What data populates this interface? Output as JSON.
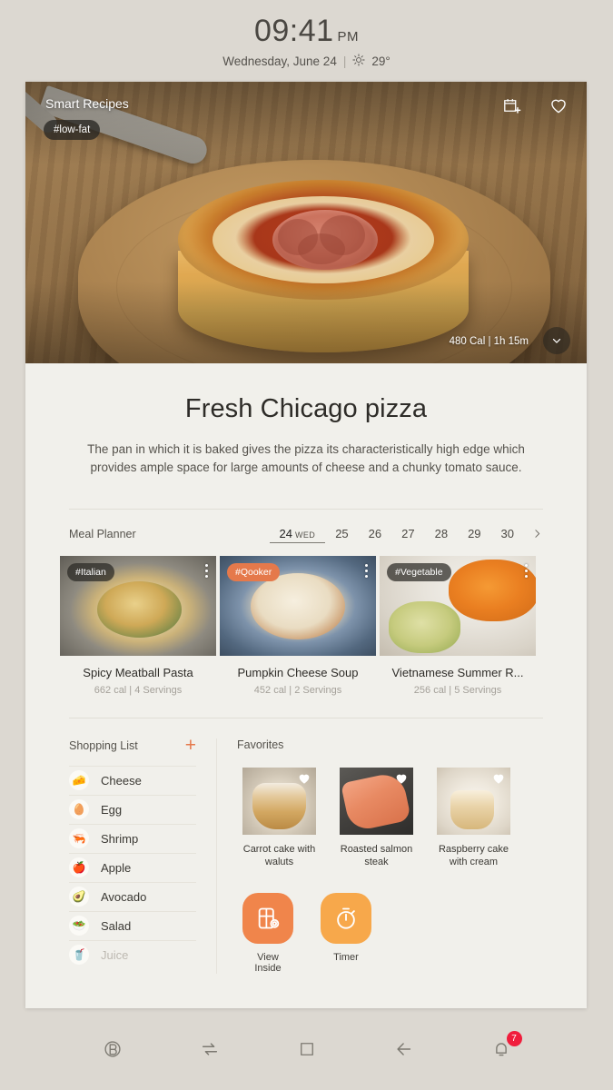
{
  "statusbar": {
    "time": "09:41",
    "ampm": "PM",
    "date": "Wednesday, June 24",
    "separator": "|",
    "temperature": "29°",
    "weather_icon": "sun-icon"
  },
  "hero": {
    "app_title": "Smart Recipes",
    "tag": "#low-fat",
    "meta": "480 Cal | 1h 15m",
    "icons": {
      "add_to_calendar": "calendar-plus-icon",
      "favorite": "heart-outline-icon",
      "expand": "chevron-down-icon"
    }
  },
  "recipe": {
    "title": "Fresh Chicago pizza",
    "description": "The pan in which it is baked gives the pizza its characteristically high edge which provides ample space for large amounts of cheese and a chunky tomato sauce."
  },
  "meal_planner": {
    "label": "Meal Planner",
    "selected_day": "24",
    "selected_dow": "WED",
    "days": [
      "25",
      "26",
      "27",
      "28",
      "29",
      "30"
    ],
    "next_icon": "chevron-right-icon",
    "cards": [
      {
        "tag": "#Italian",
        "tag_style": "dark",
        "name": "Spicy Meatball Pasta",
        "info": "662 cal | 4 Servings"
      },
      {
        "tag": "#Qooker",
        "tag_style": "orange",
        "name": "Pumpkin Cheese Soup",
        "info": "452 cal | 2 Servings"
      },
      {
        "tag": "#Vegetable",
        "tag_style": "dark",
        "name": "Vietnamese Summer R...",
        "info": "256 cal | 5 Servings"
      }
    ]
  },
  "shopping_list": {
    "title": "Shopping List",
    "add_icon": "plus-icon",
    "add_label": "+",
    "items": [
      {
        "name": "Cheese",
        "icon": "cheese-icon",
        "glyph": "🧀",
        "faded": false
      },
      {
        "name": "Egg",
        "icon": "egg-icon",
        "glyph": "🥚",
        "faded": false
      },
      {
        "name": "Shrimp",
        "icon": "shrimp-icon",
        "glyph": "🦐",
        "faded": false
      },
      {
        "name": "Apple",
        "icon": "apple-icon",
        "glyph": "🍎",
        "faded": false
      },
      {
        "name": "Avocado",
        "icon": "avocado-icon",
        "glyph": "🥑",
        "faded": false
      },
      {
        "name": "Salad",
        "icon": "salad-icon",
        "glyph": "🥗",
        "faded": false
      },
      {
        "name": "Juice",
        "icon": "juice-icon",
        "glyph": "🥤",
        "faded": true
      }
    ]
  },
  "favorites": {
    "title": "Favorites",
    "heart_icon": "heart-filled-icon",
    "items": [
      {
        "name": "Carrot cake\nwith waluts"
      },
      {
        "name": "Roasted\nsalmon steak"
      },
      {
        "name": "Raspberry\ncake with cream"
      }
    ],
    "names": {
      "one": "Carrot cake with waluts",
      "two": "Roasted salmon steak",
      "three": "Raspberry cake with cream"
    }
  },
  "actions": [
    {
      "label": "View Inside",
      "icon": "fridge-camera-icon",
      "color": "#f0854b"
    },
    {
      "label": "Timer",
      "icon": "stopwatch-icon",
      "color": "#f7a84b"
    }
  ],
  "navbar": {
    "items": [
      {
        "name": "bixby-icon"
      },
      {
        "name": "transfer-icon"
      },
      {
        "name": "recents-icon"
      },
      {
        "name": "back-icon"
      },
      {
        "name": "notifications-icon",
        "badge": "7"
      }
    ],
    "badge_count": "7"
  },
  "colors": {
    "accent_orange": "#e5794b",
    "timer_orange": "#f7a84b",
    "badge_red": "#f01d3c",
    "panel_bg": "#f1f0eb",
    "desktop_bg": "#dcd8d1"
  }
}
